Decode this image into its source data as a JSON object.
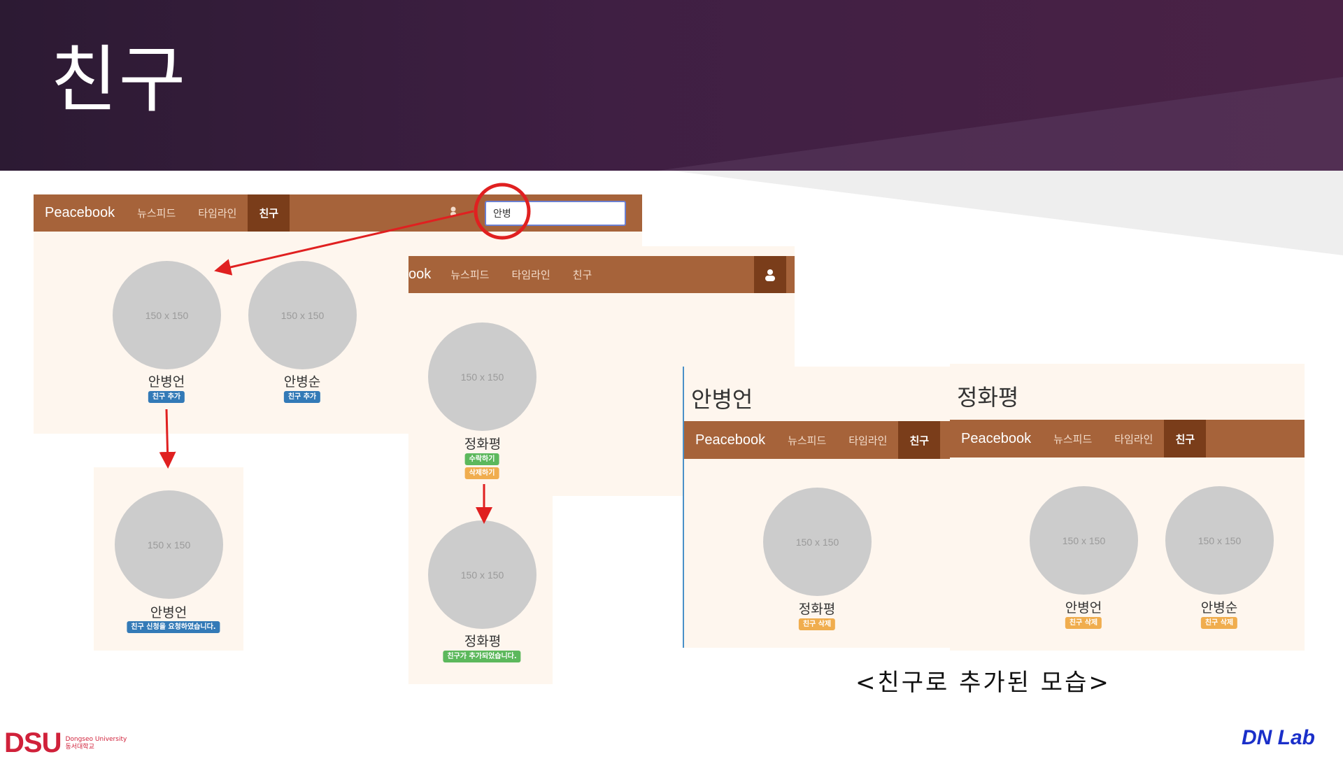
{
  "slide": {
    "title": "친구"
  },
  "screen1": {
    "brand": "Peacebook",
    "nav": [
      "뉴스피드",
      "타임라인",
      "친구"
    ],
    "search_value": "안병",
    "results": [
      {
        "avatar": "150 x 150",
        "name": "안병언",
        "badge": "친구 추가"
      },
      {
        "avatar": "150 x 150",
        "name": "안병순",
        "badge": "친구 추가"
      }
    ]
  },
  "screen1b": {
    "avatar": "150 x 150",
    "name": "안병언",
    "badge": "친구 신청을 요청하였습니다."
  },
  "screen2": {
    "brand_fragment": "ook",
    "nav": [
      "뉴스피드",
      "타임라인",
      "친구"
    ],
    "request": {
      "avatar": "150 x 150",
      "name": "정화평",
      "accept": "수락하기",
      "delete": "삭제하기"
    }
  },
  "screen2b": {
    "avatar": "150 x 150",
    "name": "정화평",
    "badge": "친구가 추가되었습니다."
  },
  "screen3": {
    "heading": "안병언",
    "brand": "Peacebook",
    "nav": [
      "뉴스피드",
      "타임라인",
      "친구"
    ],
    "friends": [
      {
        "avatar": "150 x 150",
        "name": "정화평",
        "badge": "친구 삭제"
      }
    ]
  },
  "screen4": {
    "heading": "정화평",
    "brand": "Peacebook",
    "nav": [
      "뉴스피드",
      "타임라인",
      "친구"
    ],
    "friends": [
      {
        "avatar": "150 x 150",
        "name": "안병언",
        "badge": "친구 삭제"
      },
      {
        "avatar": "150 x 150",
        "name": "안병순",
        "badge": "친구 삭제"
      }
    ]
  },
  "caption": "<친구로 추가된 모습>",
  "footer": {
    "logo_mark": "DSU",
    "logo_en": "Dongseo University",
    "logo_kr": "동서대학교",
    "lab": "DN Lab"
  },
  "colors": {
    "nav_bg": "#a6633a",
    "nav_active": "#7a3d1a",
    "panel_bg": "#fef6ee",
    "badge_blue": "#337ab7",
    "badge_green": "#5cb85c",
    "badge_orange": "#f0ad4e",
    "annotation_red": "#e02020"
  },
  "icons": [
    "user-icon"
  ]
}
